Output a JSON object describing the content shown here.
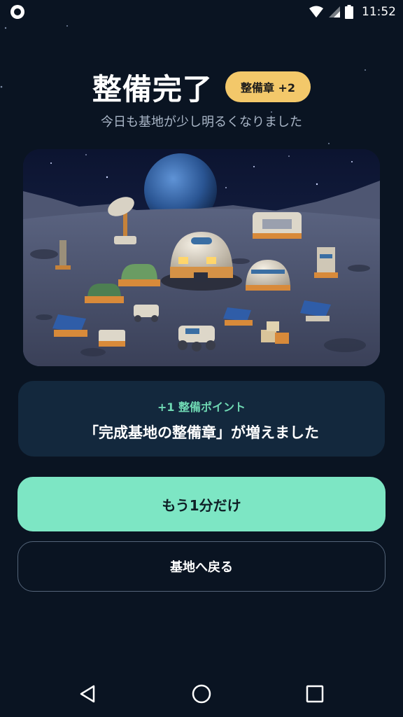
{
  "status_bar": {
    "time": "11:52",
    "icons": [
      "notification-dot-icon",
      "wifi-icon",
      "signal-icon",
      "battery-icon"
    ]
  },
  "header": {
    "title": "整備完了",
    "badge": "整備章 +2",
    "subtitle": "今日も基地が少し明るくなりました"
  },
  "illustration": {
    "icon": "moon-base-illustration"
  },
  "reward": {
    "points": "+1 整備ポイント",
    "message": "「完成基地の整備章」が増えました"
  },
  "actions": {
    "primary_label": "もう1分だけ",
    "secondary_label": "基地へ戻る"
  },
  "nav": {
    "icons": [
      "back-icon",
      "home-icon",
      "recents-icon"
    ]
  },
  "colors": {
    "background": "#0a1422",
    "badge": "#f3c86a",
    "accent": "#7de6c4",
    "card": "#13283d",
    "points_text": "#6fd8b3"
  }
}
